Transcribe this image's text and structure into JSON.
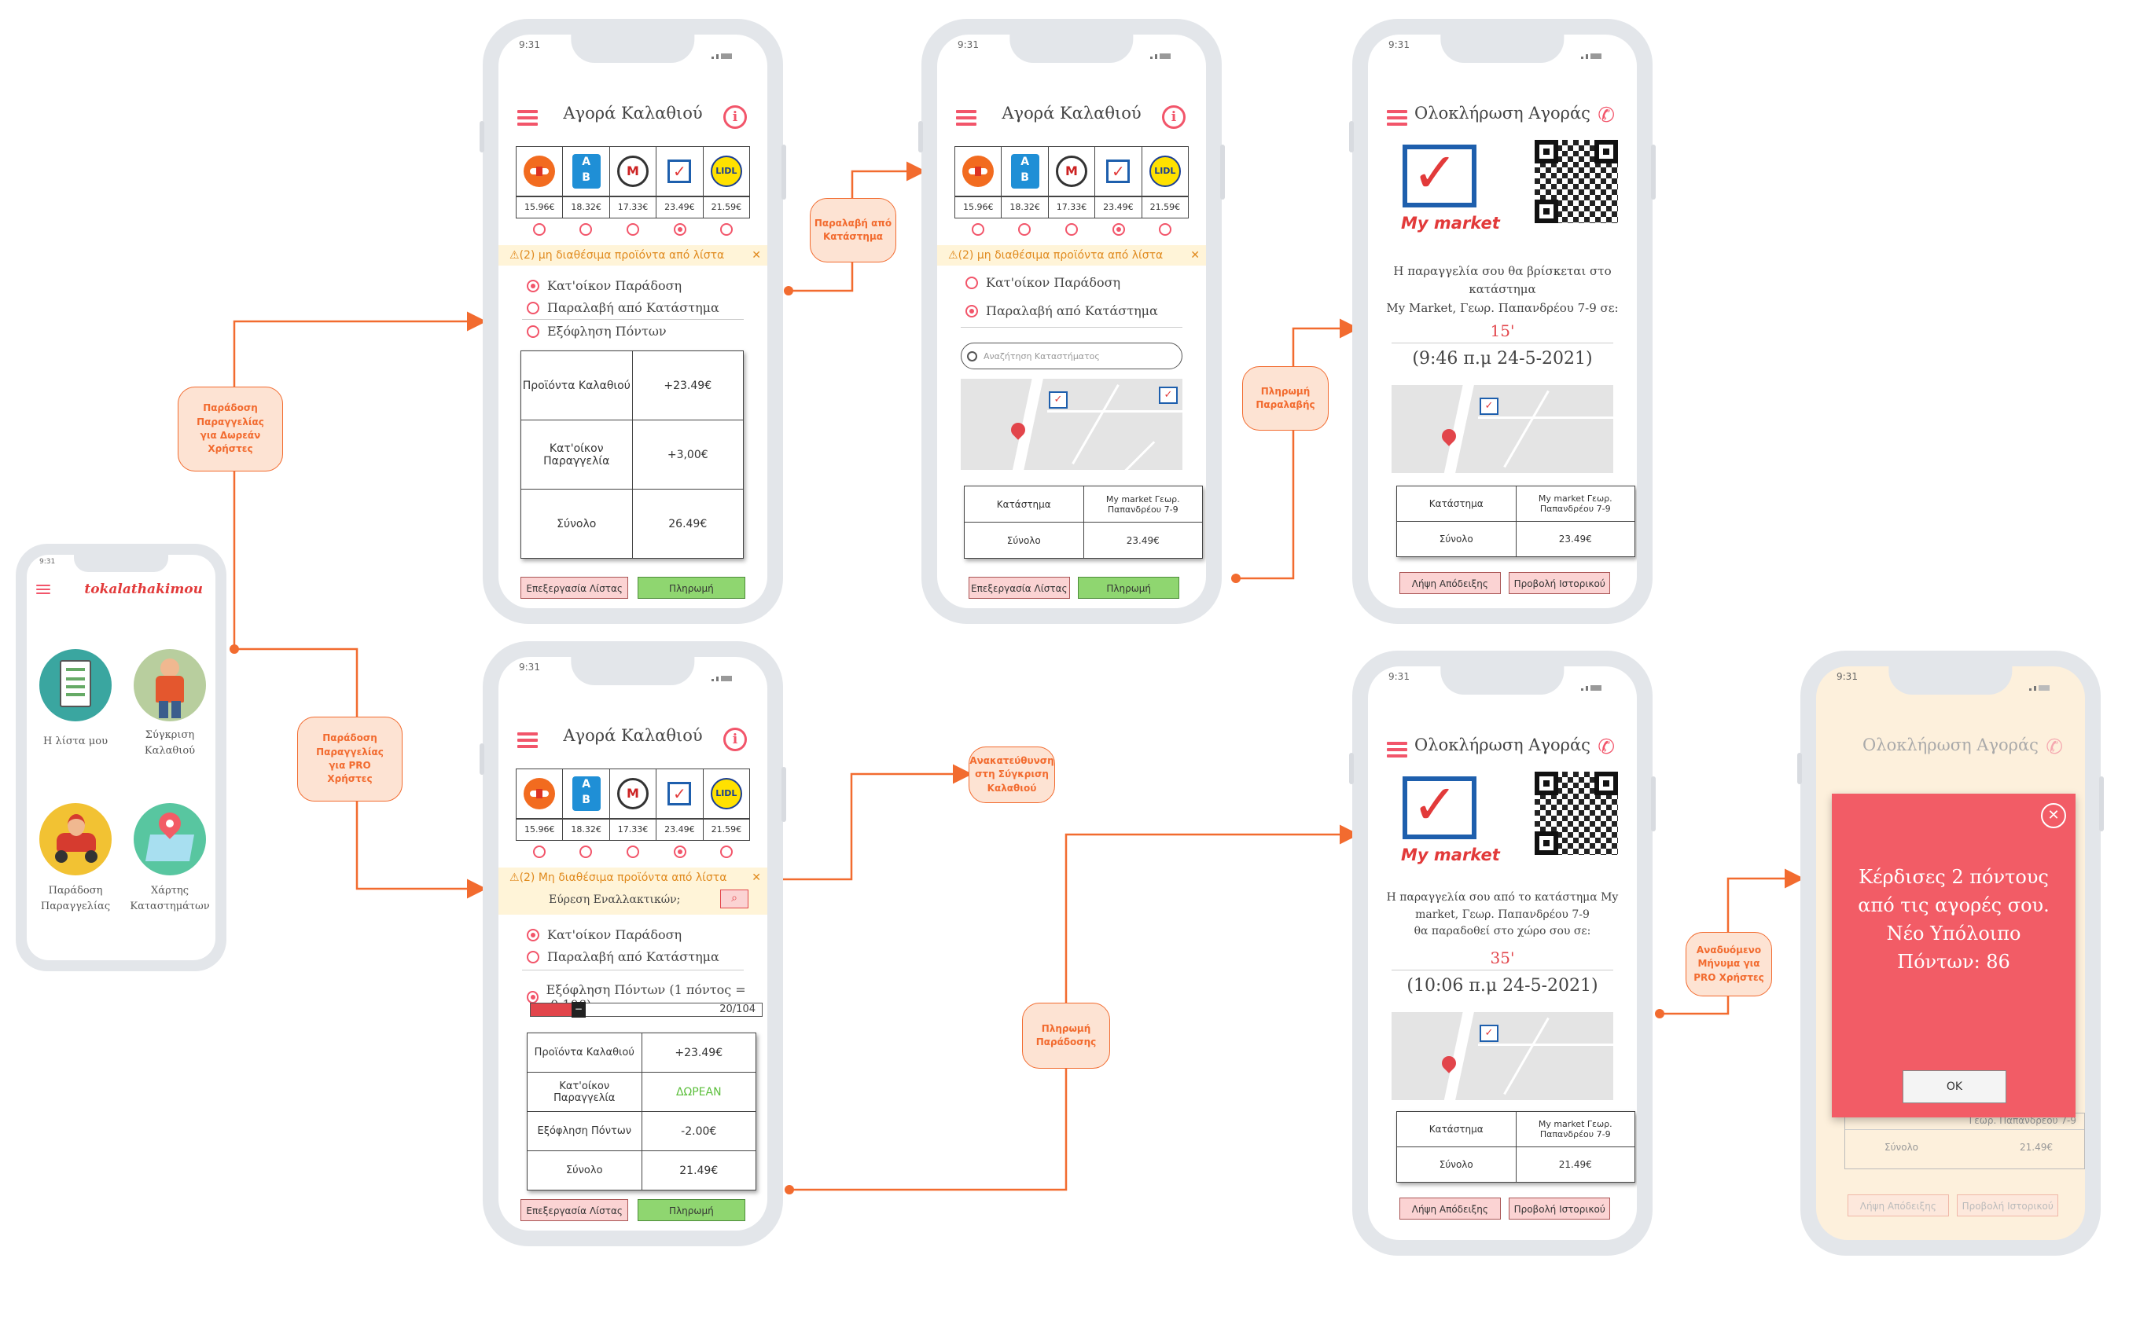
{
  "flow_labels": {
    "free_delivery": [
      "Παράδοση",
      "Παραγγελίας",
      "για Δωρεάν",
      "Χρήστες"
    ],
    "pro_delivery": [
      "Παράδοση",
      "Παραγγελίας",
      "για PRO",
      "Χρήστες"
    ],
    "store_pickup": [
      "Παραλαβή από",
      "Κατάστημα"
    ],
    "payment_pickup": [
      "Πληρωμή",
      "Παραλαβής"
    ],
    "redirect": [
      "Ανακατεύθυνση",
      "στη Σύγκριση",
      "Καλαθιού"
    ],
    "payment_delivery": [
      "Πληρωμή",
      "Παράδοσης"
    ],
    "popup_pro": [
      "Αναδυόμενο",
      "Μήνυμα για",
      "PRO Χρήστες"
    ]
  },
  "status_time": "9:31",
  "home": {
    "brand": "tokalathakimou",
    "tiles": [
      {
        "label": "Η λίστα μου",
        "icon": "checklist-icon"
      },
      {
        "label": "Σύγκριση Καλαθιού",
        "icon": "shopper-icon"
      },
      {
        "label": "Παράδοση Παραγγελίας",
        "icon": "delivery-scooter-icon"
      },
      {
        "label": "Χάρτης Καταστημάτων",
        "icon": "map-pin-icon"
      }
    ]
  },
  "basket": {
    "title": "Αγορά Καλαθιού",
    "stores": [
      "sklavenitis-logo",
      "ab-logo",
      "masoutis-logo",
      "mymarket-logo",
      "lidl-logo"
    ],
    "prices": [
      "15.96€",
      "18.32€",
      "17.33€",
      "23.49€",
      "21.59€"
    ],
    "selected_store_index": 3,
    "warning": "(2) μη διαθέσιμα προϊόντα από λίστα",
    "warning_pro": "(2) Μη διαθέσιμα προϊόντα από λίστα",
    "alternatives": "Εύρεση Εναλλακτικών;",
    "opt_delivery": "Κατ'οίκον Παράδοση",
    "opt_pickup": "Παραλαβή από Κατάστημα",
    "opt_points": "Εξόφληση Πόντων",
    "opt_points_pro": "Εξόφληση Πόντων (1 πόντος = -0.10€)",
    "points_progress": "20/104",
    "points_fraction": 0.19,
    "btn_edit": "Επεξεργασία Λίστας",
    "btn_pay": "Πληρωμή",
    "free_table": [
      [
        "Προϊόντα Καλαθιού",
        "+23.49€"
      ],
      [
        "Κατ'οίκον Παραγγελία",
        "+3,00€"
      ],
      [
        "Σύνολο",
        "26.49€"
      ]
    ],
    "pro_table": [
      [
        "Προϊόντα Καλαθιού",
        "+23.49€"
      ],
      [
        "Κατ'οίκον Παραγγελία",
        "ΔΩΡΕΑΝ"
      ],
      [
        "Εξόφληση Πόντων",
        "-2.00€"
      ],
      [
        "Σύνολο",
        "21.49€"
      ]
    ]
  },
  "pickup": {
    "search_placeholder": "Αναζήτηση Καταστήματος",
    "table": [
      [
        "Κατάστημα",
        "My market Γεωρ. Παπανδρέου 7-9"
      ],
      [
        "Σύνολο",
        "23.49€"
      ]
    ]
  },
  "complete": {
    "title": "Ολοκλήρωση Αγοράς",
    "brand": "My market",
    "pickup_msg": [
      "Η παραγγελία σου θα βρίσκεται στο",
      "κατάστημα",
      "My Market, Γεωρ. Παπανδρέου 7-9 σε:"
    ],
    "pickup_minutes": "15'",
    "pickup_time": "(9:46 π.μ 24-5-2021)",
    "pickup_table": [
      [
        "Κατάστημα",
        "My market Γεωρ. Παπανδρέου 7-9"
      ],
      [
        "Σύνολο",
        "23.49€"
      ]
    ],
    "delivery_msg": [
      "Η παραγγελία σου από το κατάστημα My",
      "market, Γεωρ. Παπανδρέου 7-9",
      "θα παραδοθεί στο χώρο σου σε:"
    ],
    "delivery_minutes": "35'",
    "delivery_time": "(10:06 π.μ 24-5-2021)",
    "delivery_table": [
      [
        "Κατάστημα",
        "My market Γεωρ. Παπανδρέου 7-9"
      ],
      [
        "Σύνολο",
        "21.49€"
      ]
    ],
    "btn_receipt": "Λήψη Απόδειξης",
    "btn_history": "Προβολή Ιστορικού"
  },
  "popup": {
    "lines": [
      "Κέρδισες 2 πόντους",
      "από τις αγορές σου.",
      "Νέο Υπόλοιπο",
      "Πόντων: 86"
    ],
    "ok": "OK",
    "behind_rows": [
      "Γεωρ. Παπανδρέου 7-9",
      "Σύνολο",
      "21.49€"
    ]
  },
  "colors": {
    "accent": "#f2556a",
    "flow": "#f26b2f",
    "popup": "#f25c66"
  }
}
